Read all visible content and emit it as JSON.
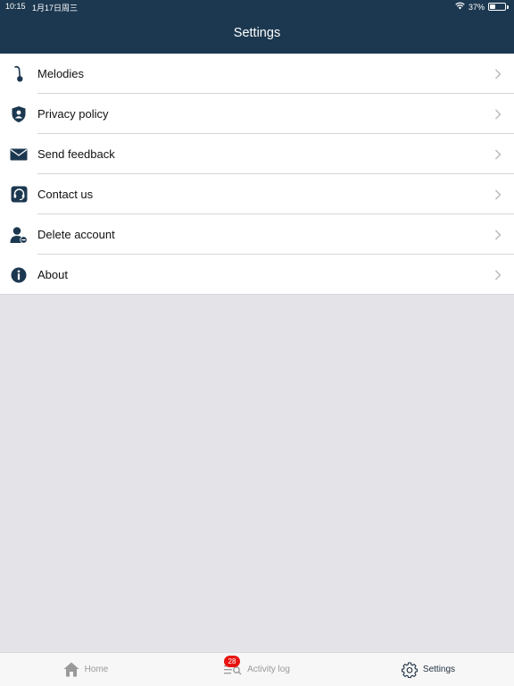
{
  "status_bar": {
    "time": "10:15",
    "date": "1月17日周三",
    "battery": "37%",
    "battery_level": 0.37
  },
  "header": {
    "title": "Settings",
    "background_color": "#1c3850"
  },
  "settings_items": [
    {
      "label": "Melodies",
      "icon": "music-note-icon"
    },
    {
      "label": "Privacy policy",
      "icon": "shield-user-icon"
    },
    {
      "label": "Send feedback",
      "icon": "envelope-icon"
    },
    {
      "label": "Contact us",
      "icon": "headset-icon"
    },
    {
      "label": "Delete account",
      "icon": "user-remove-icon"
    },
    {
      "label": "About",
      "icon": "info-icon"
    }
  ],
  "tab_bar": {
    "tabs": [
      {
        "label": "Home",
        "icon": "home-icon",
        "active": false
      },
      {
        "label": "Activity log",
        "icon": "activity-log-icon",
        "active": false,
        "badge": "28"
      },
      {
        "label": "Settings",
        "icon": "gear-icon",
        "active": true
      }
    ]
  },
  "colors": {
    "icon": "#1c3850",
    "badge": "#e8140f",
    "background": "#e4e3e8"
  }
}
